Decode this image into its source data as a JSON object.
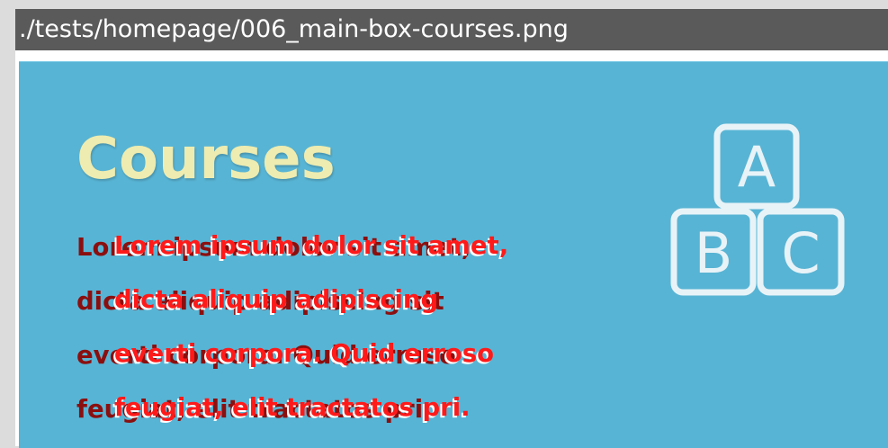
{
  "window": {
    "title": "./tests/homepage/006_main-box-courses.png"
  },
  "box": {
    "title": "Courses",
    "lines_dark": [
      "Lorem ipsum dolor sit amet,",
      "dicta aliquip adipiscing sit",
      "everti corpora. Quid erroso",
      "feugiat, elit tractatos pri."
    ],
    "lines_overlay": [
      "Lorem ipsum dolor sit amet,",
      "dicta aliquip adipiscing",
      "everti corpora. Quid erroso",
      "feugiat, elit tractatos pri."
    ],
    "icon": {
      "name": "abc-blocks-icon",
      "letters": [
        "A",
        "B",
        "C"
      ],
      "color": "#e8f3f8"
    }
  },
  "colors": {
    "background": "#dcdcdc",
    "titlebar": "#5a5a5a",
    "box": "#58b4d4",
    "title": "#eeecb0",
    "text_dark": "#8b0f0f",
    "text_red": "#ff1a1a",
    "text_white": "#ffffff"
  }
}
